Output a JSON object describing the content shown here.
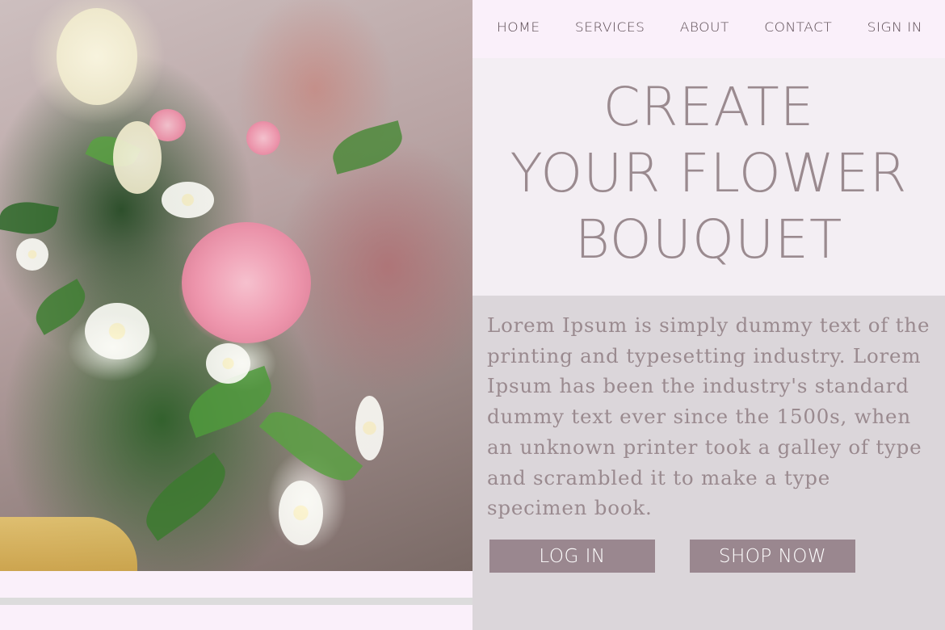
{
  "nav": {
    "items": [
      {
        "label": "HOME"
      },
      {
        "label": "SERVICES"
      },
      {
        "label": "ABOUT"
      },
      {
        "label": "CONTACT"
      },
      {
        "label": "SIGN IN"
      }
    ]
  },
  "hero": {
    "title_lines": [
      "CREATE",
      "YOUR FLOWER",
      "BOUQUET"
    ]
  },
  "content": {
    "body": "Lorem Ipsum is simply dummy text of the printing and typesetting industry. Lorem Ipsum has been the industry's standard dummy text ever since the 1500s, when an unknown printer took a galley of type and scrambled it to make a type specimen book."
  },
  "buttons": {
    "login_label": "LOG IN",
    "shop_label": "SHOP NOW"
  },
  "colors": {
    "nav_background": "#faf0fa",
    "hero_background": "#f3eef3",
    "content_background": "#dbd6da",
    "title_text": "#9a8a8f",
    "button_background": "#9a878f"
  }
}
